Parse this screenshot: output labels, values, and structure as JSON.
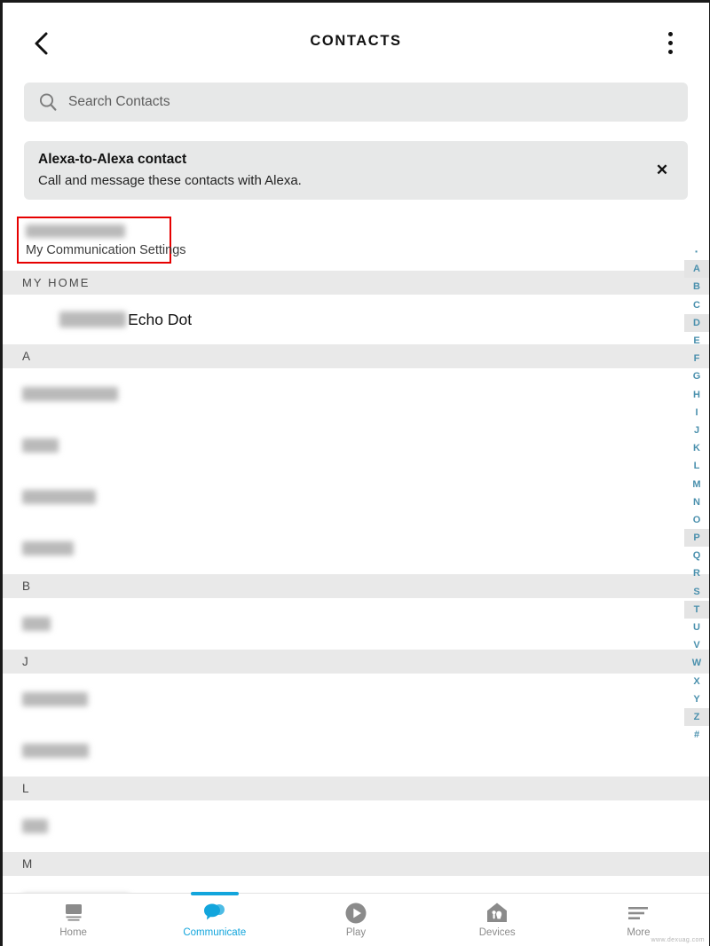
{
  "header": {
    "title": "CONTACTS",
    "back_icon": "chevron-left-icon",
    "menu_icon": "kebab-menu-icon"
  },
  "search": {
    "placeholder": "Search Contacts",
    "value": "",
    "icon": "search-icon"
  },
  "banner": {
    "title": "Alexa-to-Alexa contact",
    "subtitle": "Call and message these contacts with Alexa.",
    "close_label": "✕"
  },
  "my_settings": {
    "name_redacted": "Stephen Dark-ish",
    "label": "My Communication Settings",
    "highlight_color": "#e60000"
  },
  "sections": [
    {
      "header": "MY HOME",
      "spaced": true,
      "rows": [
        {
          "type": "device",
          "name_redacted": "Stephen's",
          "label": "Echo Dot"
        }
      ]
    },
    {
      "header": "A",
      "spaced": false,
      "rows": [
        {
          "type": "contact",
          "name_redacted": "Aaron Peterson"
        },
        {
          "type": "contact",
          "name_redacted": "Agam"
        },
        {
          "type": "contact",
          "name_redacted": "Ajith ayolika"
        },
        {
          "type": "contact",
          "name_redacted": "Amadou"
        }
      ]
    },
    {
      "header": "B",
      "spaced": false,
      "rows": [
        {
          "type": "contact",
          "name_redacted": "Beth"
        }
      ]
    },
    {
      "header": "J",
      "spaced": false,
      "rows": [
        {
          "type": "contact",
          "name_redacted": "Jan Nigam"
        },
        {
          "type": "contact",
          "name_redacted": "Jan Tendle"
        }
      ]
    },
    {
      "header": "L",
      "spaced": false,
      "rows": [
        {
          "type": "contact",
          "name_redacted": "Lolo"
        }
      ]
    },
    {
      "header": "M",
      "spaced": false,
      "rows": [
        {
          "type": "contact",
          "name_redacted": "Marlon Mounteau"
        }
      ]
    }
  ],
  "alpha_index": {
    "accent_color": "#4a90ad",
    "items": [
      {
        "label": "·",
        "shaded": false,
        "dot": true
      },
      {
        "label": "A",
        "shaded": true
      },
      {
        "label": "B",
        "shaded": false
      },
      {
        "label": "C",
        "shaded": false
      },
      {
        "label": "D",
        "shaded": true
      },
      {
        "label": "E",
        "shaded": false
      },
      {
        "label": "F",
        "shaded": false
      },
      {
        "label": "G",
        "shaded": false
      },
      {
        "label": "H",
        "shaded": false
      },
      {
        "label": "I",
        "shaded": false
      },
      {
        "label": "J",
        "shaded": false
      },
      {
        "label": "K",
        "shaded": false
      },
      {
        "label": "L",
        "shaded": false
      },
      {
        "label": "M",
        "shaded": false
      },
      {
        "label": "N",
        "shaded": false
      },
      {
        "label": "O",
        "shaded": false
      },
      {
        "label": "P",
        "shaded": true
      },
      {
        "label": "Q",
        "shaded": false
      },
      {
        "label": "R",
        "shaded": false
      },
      {
        "label": "S",
        "shaded": false
      },
      {
        "label": "T",
        "shaded": true
      },
      {
        "label": "U",
        "shaded": false
      },
      {
        "label": "V",
        "shaded": false
      },
      {
        "label": "W",
        "shaded": false
      },
      {
        "label": "X",
        "shaded": false
      },
      {
        "label": "Y",
        "shaded": false
      },
      {
        "label": "Z",
        "shaded": true
      },
      {
        "label": "#",
        "shaded": false
      }
    ]
  },
  "bottom_nav": {
    "active_color": "#12a5dc",
    "inactive_color": "#8b8b8b",
    "items": [
      {
        "label": "Home",
        "icon": "home-screen-icon",
        "active": false
      },
      {
        "label": "Communicate",
        "icon": "speech-bubbles-icon",
        "active": true
      },
      {
        "label": "Play",
        "icon": "play-circle-icon",
        "active": false
      },
      {
        "label": "Devices",
        "icon": "house-devices-icon",
        "active": false
      },
      {
        "label": "More",
        "icon": "hamburger-menu-icon",
        "active": false
      }
    ]
  },
  "watermark": "www.dexuag.com"
}
